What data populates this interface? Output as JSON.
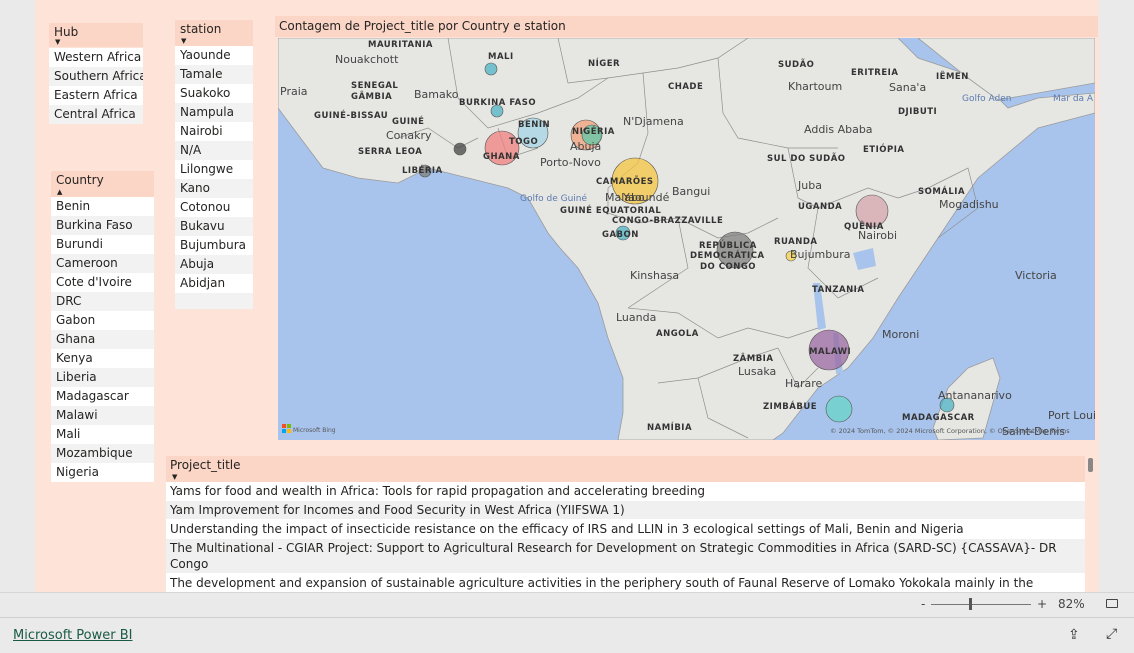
{
  "hub_slicer": {
    "title": "Hub",
    "items": [
      "Western Africa",
      "Southern Africa",
      "Eastern Africa",
      "Central Africa"
    ]
  },
  "station_slicer": {
    "title": "station",
    "items": [
      "Yaounde",
      "Tamale",
      "Suakoko",
      "Nampula",
      "Nairobi",
      "N/A",
      "Lilongwe",
      "Kano",
      "Cotonou",
      "Bukavu",
      "Bujumbura",
      "Abuja",
      "Abidjan"
    ]
  },
  "country_slicer": {
    "title": "Country",
    "items": [
      "Benin",
      "Burkina Faso",
      "Burundi",
      "Cameroon",
      "Cote d'Ivoire",
      "DRC",
      "Gabon",
      "Ghana",
      "Kenya",
      "Liberia",
      "Madagascar",
      "Malawi",
      "Mali",
      "Mozambique",
      "Nigeria"
    ]
  },
  "map": {
    "title": "Contagem de Project_title por Country e station",
    "bing_label": "Microsoft Bing",
    "copyright": "© 2024 TomTom, © 2024 Microsoft Corporation, © OpenStreetMap  Terms",
    "country_labels": [
      "MAURITANIA",
      "MALI",
      "NÍGER",
      "CHADE",
      "SUDÃO",
      "ERITREIA",
      "IÊMEN",
      "SENEGAL",
      "GÂMBIA",
      "GUINÉ-BISSAU",
      "GUINÉ",
      "SERRA LEOA",
      "LIBÉRIA",
      "BURKINA FASO",
      "BENIN",
      "TOGO",
      "GHANA",
      "NIGÉRIA",
      "CAMARÕES",
      "GUINÉ EQUATORIAL",
      "GABON",
      "CONGO-BRAZZAVILLE",
      "REPÚBLICA",
      "DEMOCRÁTICA",
      "DO CONGO",
      "SUL DO SUDÃO",
      "ETIÓPIA",
      "DJIBUTI",
      "SOMÁLIA",
      "UGANDA",
      "QUÊNIA",
      "RUANDA",
      "TANZANIA",
      "ANGOLA",
      "ZÂMBIA",
      "MALAWI",
      "ZIMBÁBUE",
      "MADAGASCAR",
      "NAMÍBIA"
    ],
    "city_labels": [
      "Nouakchott",
      "Praia",
      "Bamako",
      "Conakry",
      "Abuja",
      "N'Djamena",
      "Khartoum",
      "Sana'a",
      "Addis Ababa",
      "Mogadishu",
      "Porto-Novo",
      "Malabo",
      "Bangui",
      "Yaoundé",
      "Juba",
      "Nairobi",
      "Kinshasa",
      "Bujumbura",
      "Luanda",
      "Lusaka",
      "Harare",
      "Moroni",
      "Antananarivo",
      "Port Loui",
      "Victoria",
      "Saint-Denis"
    ],
    "sea_labels": [
      "Golfo de Guiné",
      "Golfo Aden",
      "Mar da A"
    ],
    "bubble_colors": [
      "#4fb3c6",
      "#7f7f7f",
      "#f08080",
      "#a4d6e6",
      "#f4c542",
      "#f2a07b",
      "#5cc8a8",
      "#d5a6ad",
      "#9b6aa3",
      "#6ad4c8",
      "#f7d34a",
      "#444444"
    ]
  },
  "table": {
    "header": "Project_title",
    "rows": [
      "Yams for food and wealth in Africa: Tools for rapid propagation and accelerating breeding",
      "Yam Improvement for Incomes and Food Security in West Africa (YIIFSWA 1)",
      "Understanding the impact of insecticide resistance on the efficacy of IRS and LLIN in 3 ecological settings of Mali, Benin and Nigeria",
      "The Multinational - CGIAR Project: Support to Agricultural Research for Development on Strategic Commodities in Africa (SARD-SC) {CASSAVA}- DR Congo",
      "The development and expansion of sustainable agriculture activities in the periphery south of Faunal Reserve of Lomako Yokokala mainly in the territory of Djolu and Befale (MLW Landscape"
    ]
  },
  "status": {
    "zoom_minus": "-",
    "zoom_plus": "+",
    "zoom_level": "82%"
  },
  "footer": {
    "brand": "Microsoft Power BI"
  }
}
